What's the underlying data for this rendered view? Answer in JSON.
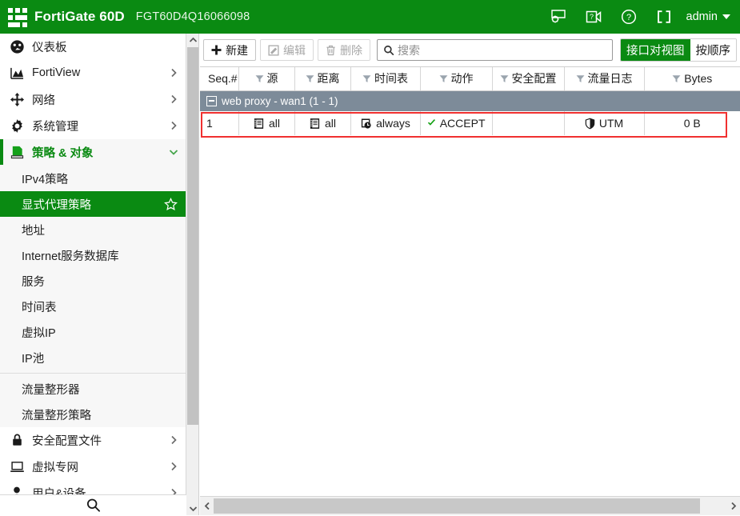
{
  "header": {
    "logo_icon": "fortigate-logo-icon",
    "product": "FortiGate 60D",
    "serial": "FGT60D4Q16066098",
    "icons": [
      {
        "name": "system-settings-icon",
        "glyph": "gear-monitor"
      },
      {
        "name": "video-tutorial-icon",
        "glyph": "video-help"
      },
      {
        "name": "help-icon",
        "glyph": "question-circle"
      },
      {
        "name": "fullscreen-icon",
        "glyph": "expand-brackets"
      }
    ],
    "admin_label": "admin",
    "brand_green": "#0a8a12"
  },
  "sidebar": {
    "items": [
      {
        "label": "仪表板",
        "icon": "dashboard-icon",
        "expandable": false,
        "state": "normal"
      },
      {
        "label": "FortiView",
        "icon": "fortiview-icon",
        "expandable": true,
        "state": "normal"
      },
      {
        "label": "网络",
        "icon": "network-icon",
        "expandable": true,
        "state": "normal"
      },
      {
        "label": "系统管理",
        "icon": "system-gear-icon",
        "expandable": true,
        "state": "normal"
      },
      {
        "label": "策略 & 对象",
        "icon": "policy-objects-icon",
        "expandable": true,
        "state": "open"
      }
    ],
    "sub_items": [
      {
        "label": "IPv4策略",
        "selected": false,
        "separator_after": false
      },
      {
        "label": "显式代理策略",
        "selected": true,
        "separator_after": false,
        "favorite_icon": "star-icon"
      },
      {
        "label": "地址",
        "selected": false,
        "separator_after": false
      },
      {
        "label": "Internet服务数据库",
        "selected": false,
        "separator_after": false
      },
      {
        "label": "服务",
        "selected": false,
        "separator_after": false
      },
      {
        "label": "时间表",
        "selected": false,
        "separator_after": false
      },
      {
        "label": "虚拟IP",
        "selected": false,
        "separator_after": false
      },
      {
        "label": "IP池",
        "selected": false,
        "separator_after": true
      },
      {
        "label": "流量整形器",
        "selected": false,
        "separator_after": false
      },
      {
        "label": "流量整形策略",
        "selected": false,
        "separator_after": false
      }
    ],
    "items_after": [
      {
        "label": "安全配置文件",
        "icon": "lock-icon",
        "expandable": true,
        "state": "normal"
      },
      {
        "label": "虚拟专网",
        "icon": "laptop-icon",
        "expandable": true,
        "state": "normal"
      },
      {
        "label": "用户&设备",
        "icon": "user-icon",
        "expandable": true,
        "state": "normal"
      }
    ],
    "search_icon": "search-icon",
    "selected_bg": "#0a8a12"
  },
  "toolbar": {
    "new_label": "新建",
    "edit_label": "编辑",
    "delete_label": "删除",
    "search_placeholder": "搜索",
    "view_interface_pairs": "接口对视图",
    "view_by_sequence": "按顺序",
    "active_view": "接口对视图"
  },
  "table": {
    "columns": [
      {
        "label": "Seq.#",
        "filterable": false
      },
      {
        "label": "源",
        "filterable": true
      },
      {
        "label": "距离",
        "filterable": true
      },
      {
        "label": "时间表",
        "filterable": true
      },
      {
        "label": "动作",
        "filterable": true
      },
      {
        "label": "安全配置",
        "filterable": true
      },
      {
        "label": "流量日志",
        "filterable": true
      },
      {
        "label": "Bytes",
        "filterable": true
      }
    ],
    "group": {
      "label": "web proxy - wan1 (1 - 1)",
      "collapse_icon": "collapse-minus-icon",
      "bg": "#7d8b99"
    },
    "rows": [
      {
        "highlighted": true,
        "highlight_color": "#f03030",
        "cells": [
          {
            "text": "1",
            "icon": null,
            "align": "left"
          },
          {
            "text": "all",
            "icon": "address-book-icon",
            "align": "center"
          },
          {
            "text": "all",
            "icon": "address-book-icon",
            "align": "center"
          },
          {
            "text": "always",
            "icon": "schedule-clock-icon",
            "align": "center"
          },
          {
            "text": "ACCEPT",
            "icon": "check-accept-icon",
            "align": "center"
          },
          {
            "text": "",
            "icon": null,
            "align": "center"
          },
          {
            "text": "UTM",
            "icon": "shield-icon",
            "align": "center"
          },
          {
            "text": "0 B",
            "icon": null,
            "align": "center"
          }
        ]
      }
    ]
  },
  "scrollbars": {
    "sidebar_up": "scroll-up-arrow-icon",
    "sidebar_down": "scroll-down-arrow-icon",
    "h_left": "scroll-left-arrow-icon",
    "h_right": "scroll-right-arrow-icon"
  }
}
